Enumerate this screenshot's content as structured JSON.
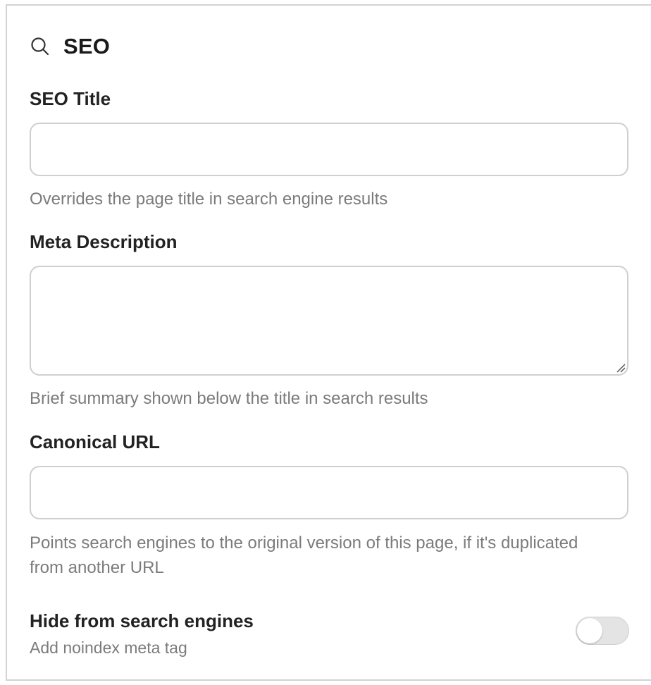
{
  "section": {
    "title": "SEO",
    "icon": "search-icon"
  },
  "fields": {
    "seo_title": {
      "label": "SEO Title",
      "value": "",
      "placeholder": "",
      "help": "Overrides the page title in search engine results"
    },
    "meta_description": {
      "label": "Meta Description",
      "value": "",
      "placeholder": "",
      "help": "Brief summary shown below the title in search results"
    },
    "canonical_url": {
      "label": "Canonical URL",
      "value": "",
      "placeholder": "",
      "help": "Points search engines to the original version of this page, if it's duplicated from another URL"
    }
  },
  "noindex": {
    "title": "Hide from search engines",
    "subtitle": "Add noindex meta tag",
    "enabled": false
  }
}
